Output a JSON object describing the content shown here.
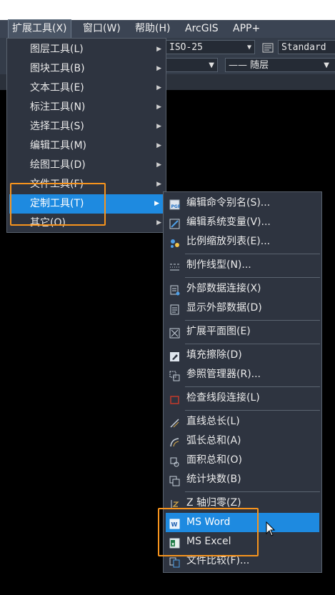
{
  "menubar": {
    "items": [
      "扩展工具(X)",
      "窗口(W)",
      "帮助(H)",
      "ArcGIS",
      "APP+"
    ]
  },
  "toolbar": {
    "dimstyle": "ISO-25",
    "textstyle": "Standard",
    "linetype": "—— 随层"
  },
  "ext_menu": {
    "items": [
      {
        "label": "图层工具(L)"
      },
      {
        "label": "图块工具(B)"
      },
      {
        "label": "文本工具(E)"
      },
      {
        "label": "标注工具(N)"
      },
      {
        "label": "选择工具(S)"
      },
      {
        "label": "编辑工具(M)"
      },
      {
        "label": "绘图工具(D)"
      },
      {
        "label": "文件工具(F)"
      },
      {
        "label": "定制工具(T)"
      },
      {
        "label": "其它(O)"
      }
    ],
    "highlighted": "定制工具(T)"
  },
  "custom_menu": {
    "items": [
      {
        "label": "编辑命令别名(S)...",
        "icon": "pgp-file-icon"
      },
      {
        "label": "编辑系统变量(V)...",
        "icon": "sysvar-icon"
      },
      {
        "label": "比例缩放列表(E)...",
        "icon": "scale-list-icon"
      },
      {
        "label": "制作线型(N)...",
        "icon": "linetype-icon"
      },
      {
        "label": "外部数据连接(X)",
        "icon": "data-link-icon"
      },
      {
        "label": "显示外部数据(D)",
        "icon": "data-view-icon"
      },
      {
        "label": "扩展平面图(E)",
        "icon": "plan-icon"
      },
      {
        "label": "填充擦除(D)",
        "icon": "fill-erase-icon"
      },
      {
        "label": "参照管理器(R)...",
        "icon": "xref-manager-icon"
      },
      {
        "label": "检查线段连接(L)",
        "icon": "check-line-icon"
      },
      {
        "label": "直线总长(L)",
        "icon": "line-length-icon"
      },
      {
        "label": "弧长总和(A)",
        "icon": "arc-length-icon"
      },
      {
        "label": "面积总和(O)",
        "icon": "area-sum-icon"
      },
      {
        "label": "统计块数(B)",
        "icon": "block-count-icon"
      },
      {
        "label": "Z 轴归零(Z)",
        "icon": "z-zero-icon"
      },
      {
        "label": "MS Word",
        "icon": "ms-word-icon"
      },
      {
        "label": "MS Excel",
        "icon": "ms-excel-icon"
      },
      {
        "label": "文件比较(F)...",
        "icon": "file-compare-icon"
      }
    ],
    "highlighted": "MS Word"
  },
  "colors": {
    "menu_bg": "#2e3440",
    "highlight": "#1e8ae0",
    "annotation": "#f7941d"
  }
}
